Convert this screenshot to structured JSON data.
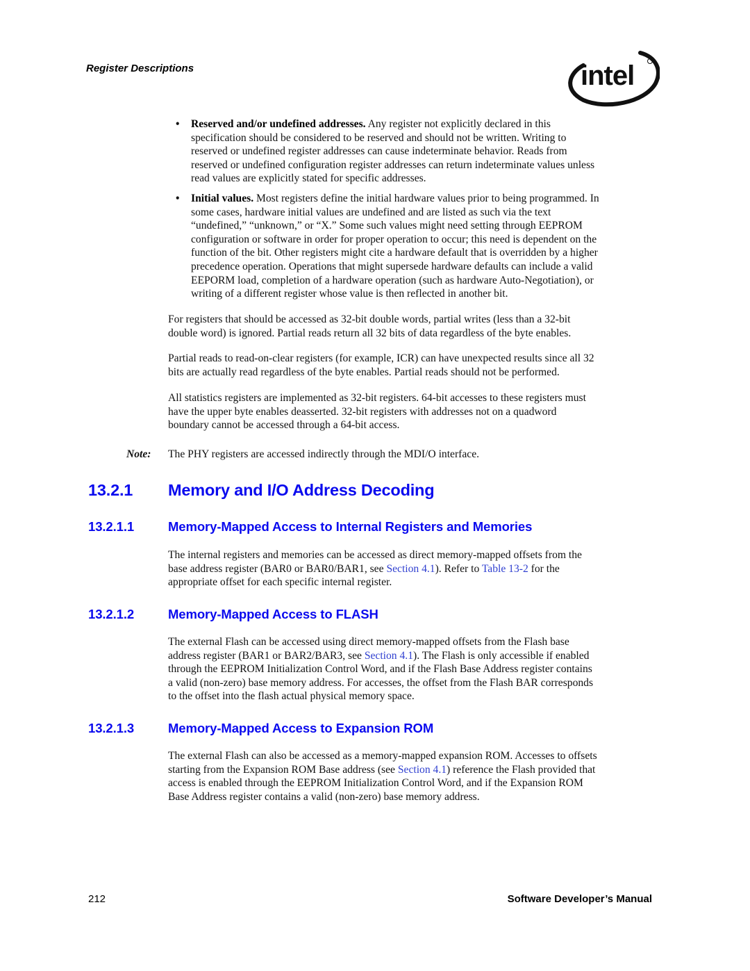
{
  "header": {
    "running_head": "Register Descriptions",
    "logo": {
      "icon": "intel-logo-icon",
      "text": "intel",
      "registered_mark": "®"
    }
  },
  "bullets": [
    {
      "lead": "Reserved and/or undefined addresses.",
      "lines": [
        " Any register not explicitly declared in this",
        "specification should be considered to be reserved and should not be written. Writing to",
        "reserved or undefined register addresses can cause indeterminate behavior. Reads from",
        "reserved or undefined configuration register addresses can return indeterminate values unless",
        "read values are explicitly stated for specific addresses."
      ]
    },
    {
      "lead": "Initial values.",
      "lines": [
        " Most registers define the initial hardware values prior to being programmed. In",
        "some cases, hardware initial values are undefined and are listed as such via the text",
        "“undefined,” “unknown,” or “X.” Some such values might need setting through EEPROM",
        "configuration or software in order for proper operation to occur; this need is dependent on the",
        "function of the bit. Other registers might cite a hardware default that is overridden by a higher",
        "precedence operation. Operations that might supersede hardware defaults can include a valid",
        "EEPORM load, completion of a hardware operation (such as hardware Auto-Negotiation), or",
        "writing of a different register whose value is then reflected in another bit."
      ]
    }
  ],
  "paragraphs": [
    {
      "lines": [
        "For registers that should be accessed as 32-bit double words, partial writes (less than a 32-bit",
        "double word) is ignored. Partial reads return all 32 bits of data regardless of the byte enables."
      ]
    },
    {
      "lines": [
        "Partial reads to read-on-clear registers (for example, ICR) can have unexpected results since all 32",
        "bits are actually read regardless of the byte enables. Partial reads should not be performed."
      ]
    },
    {
      "lines": [
        "All statistics registers are implemented as 32-bit registers. 64-bit accesses to these registers must",
        "have the upper byte enables deasserted. 32-bit registers with addresses not on a quadword",
        "boundary cannot be accessed through a 64-bit access."
      ]
    }
  ],
  "note": {
    "label": "Note:",
    "text": "The PHY registers are accessed indirectly through the MDI/O interface."
  },
  "section": {
    "number": "13.2.1",
    "title": "Memory and I/O Address Decoding"
  },
  "subsections": [
    {
      "number": "13.2.1.1",
      "title": "Memory-Mapped Access to Internal Registers and Memories",
      "body": {
        "l1": "The internal registers and memories can be accessed as direct memory-mapped offsets from the",
        "l2_a": "base address register (BAR0 or BAR0/BAR1, see ",
        "l2_link1": "Section 4.1",
        "l2_b": "). Refer to ",
        "l2_link2": "Table 13-2",
        "l2_c": " for the",
        "l3": "appropriate offset for each specific internal register."
      }
    },
    {
      "number": "13.2.1.2",
      "title": "Memory-Mapped Access to FLASH",
      "body": {
        "l1": "The external Flash can be accessed using direct memory-mapped offsets from the Flash base",
        "l2_a": "address register (BAR1 or BAR2/BAR3, see ",
        "l2_link1": "Section 4.1",
        "l2_b": "). The Flash is only accessible if enabled",
        "l3": "through the EEPROM Initialization Control Word, and if the Flash Base Address register contains",
        "l4": "a valid (non-zero) base memory address. For accesses, the offset from the Flash BAR corresponds",
        "l5": "to the offset into the flash actual physical memory space."
      }
    },
    {
      "number": "13.2.1.3",
      "title": "Memory-Mapped Access to Expansion ROM",
      "body": {
        "l1": "The external Flash can also be accessed as a memory-mapped expansion ROM. Accesses to offsets",
        "l2_a": "starting from the Expansion ROM Base address (see ",
        "l2_link1": "Section 4.1",
        "l2_b": ") reference the Flash provided that",
        "l3": "access is enabled through the EEPROM Initialization Control Word, and if the Expansion ROM",
        "l4": "Base Address register contains a valid (non-zero) base memory address."
      }
    }
  ],
  "footer": {
    "page_number": "212",
    "manual_title": "Software Developer’s Manual"
  },
  "colors": {
    "heading_blue": "#0a0aee",
    "link_blue": "#2f3fd0",
    "body_text": "#111111"
  }
}
